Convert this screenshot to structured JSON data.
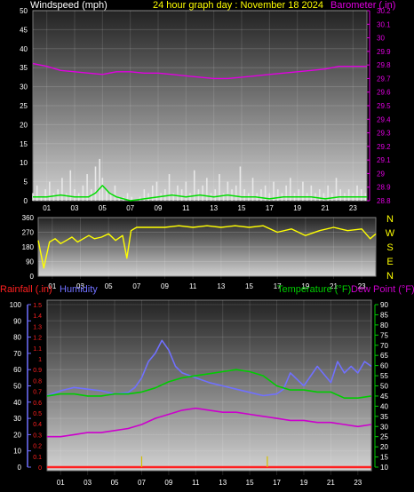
{
  "header": {
    "wind_title": "Windspeed (mph)",
    "center_title": "24 hour graph day : November 18 2024",
    "baro_title": "Barometer (.in)"
  },
  "bottom_titles": {
    "rain": "Rainfall (.in)",
    "humidity": "Humidity",
    "temperature": "Temperature (°F)",
    "dewpoint": "Dew Point (°F)"
  },
  "direction_letters": [
    "N",
    "W",
    "S",
    "E",
    "N"
  ],
  "colors": {
    "wind_gust": "#e8e8e8",
    "wind_avg": "#00dd00",
    "barometer": "#e000e0",
    "direction": "#ffff00",
    "humidity": "#7070ff",
    "temperature": "#00cc00",
    "dewpoint": "#cc00cc",
    "rain": "#ff2020",
    "title_yellow": "#ffff00",
    "title_white": "#ffffff"
  },
  "chart_data": [
    {
      "type": "line",
      "name": "wind-barometer",
      "x_ticks": [
        "01",
        "03",
        "05",
        "07",
        "09",
        "11",
        "13",
        "15",
        "17",
        "19",
        "21",
        "23"
      ],
      "xlim": [
        0,
        24
      ],
      "y_left_ticks": [
        "0",
        "5",
        "10",
        "15",
        "20",
        "25",
        "30",
        "35",
        "40",
        "45",
        "50"
      ],
      "ylim_left": [
        0,
        50
      ],
      "y_right_ticks": [
        "28.8",
        "28.9",
        "29",
        "29.1",
        "29.2",
        "29.3",
        "29.4",
        "29.5",
        "29.6",
        "29.7",
        "29.8",
        "29.9",
        "30",
        "30.1",
        "30.2"
      ],
      "ylim_right": [
        28.8,
        30.2
      ],
      "series": [
        {
          "name": "Windspeed (mph)",
          "axis": "left",
          "style": "gust",
          "x": [
            0,
            0.3,
            0.6,
            0.9,
            1.2,
            1.5,
            1.8,
            2.1,
            2.4,
            2.7,
            3,
            3.3,
            3.6,
            3.9,
            4.2,
            4.5,
            4.8,
            5,
            5.3,
            5.6,
            5.9,
            6.2,
            6.5,
            6.8,
            7.1,
            7.4,
            7.7,
            8,
            8.3,
            8.6,
            8.9,
            9.2,
            9.5,
            9.8,
            10.1,
            10.4,
            10.7,
            11,
            11.3,
            11.6,
            11.9,
            12.2,
            12.5,
            12.8,
            13.1,
            13.4,
            13.7,
            14,
            14.3,
            14.6,
            14.9,
            15.2,
            15.5,
            15.8,
            16.1,
            16.4,
            16.7,
            17,
            17.3,
            17.6,
            17.9,
            18.2,
            18.5,
            18.8,
            19.1,
            19.4,
            19.7,
            20,
            20.3,
            20.6,
            20.9,
            21.2,
            21.5,
            21.8,
            22.1,
            22.4,
            22.7,
            23,
            23.3,
            23.6,
            23.9
          ],
          "y": [
            2,
            4,
            1,
            3,
            5,
            2,
            3,
            6,
            2,
            8,
            3,
            2,
            4,
            7,
            3,
            9,
            11,
            6,
            3,
            2,
            4,
            1,
            1,
            2,
            1,
            0,
            1,
            3,
            2,
            4,
            5,
            2,
            3,
            7,
            2,
            4,
            3,
            5,
            2,
            8,
            3,
            4,
            6,
            2,
            3,
            7,
            2,
            5,
            3,
            4,
            9,
            3,
            2,
            6,
            2,
            3,
            4,
            2,
            5,
            3,
            2,
            4,
            6,
            2,
            3,
            5,
            2,
            4,
            2,
            3,
            2,
            4,
            2,
            6,
            3,
            2,
            3,
            2,
            4,
            3,
            2
          ]
        },
        {
          "name": "Average wind (mph)",
          "axis": "left",
          "style": "avg",
          "x": [
            0,
            1,
            2,
            3,
            4,
            4.5,
            5,
            5.5,
            6,
            7,
            8,
            9,
            10,
            11,
            12,
            13,
            14,
            15,
            16,
            17,
            18,
            19,
            20,
            21,
            22,
            23,
            24
          ],
          "y": [
            1,
            1,
            1.5,
            1,
            1,
            2,
            4,
            2,
            1,
            0,
            0.5,
            1,
            1.5,
            1,
            1.5,
            1,
            1.5,
            1,
            1,
            0.5,
            1,
            1,
            1,
            0.5,
            1,
            1,
            1
          ]
        },
        {
          "name": "Barometer (.in)",
          "axis": "right",
          "style": "baro",
          "x": [
            0,
            1,
            2,
            3,
            4,
            5,
            6,
            7,
            8,
            9,
            10,
            11,
            12,
            13,
            14,
            15,
            16,
            17,
            18,
            19,
            20,
            21,
            22,
            23,
            24
          ],
          "y": [
            29.81,
            29.79,
            29.76,
            29.75,
            29.74,
            29.73,
            29.75,
            29.75,
            29.74,
            29.74,
            29.73,
            29.72,
            29.71,
            29.7,
            29.7,
            29.71,
            29.72,
            29.73,
            29.74,
            29.75,
            29.76,
            29.77,
            29.79,
            29.79,
            29.79
          ]
        }
      ]
    },
    {
      "type": "line",
      "name": "wind-direction",
      "x_ticks": [
        "01",
        "03",
        "05",
        "07",
        "09",
        "11",
        "13",
        "15",
        "17",
        "19",
        "21",
        "23"
      ],
      "xlim": [
        0,
        24
      ],
      "y_ticks": [
        "0",
        "90",
        "180",
        "270",
        "360"
      ],
      "ylim": [
        0,
        360
      ],
      "series": [
        {
          "name": "Wind direction",
          "x": [
            0,
            0.4,
            0.8,
            1.2,
            1.6,
            2,
            2.4,
            2.8,
            3.2,
            3.6,
            4,
            4.5,
            5,
            5.5,
            6,
            6.3,
            6.6,
            7,
            8,
            9,
            10,
            11,
            12,
            13,
            14,
            15,
            16,
            17,
            18,
            19,
            20,
            21,
            22,
            23,
            23.6,
            24
          ],
          "y": [
            220,
            50,
            210,
            230,
            200,
            220,
            240,
            210,
            230,
            250,
            230,
            240,
            260,
            220,
            250,
            110,
            280,
            300,
            300,
            300,
            310,
            300,
            310,
            300,
            310,
            300,
            310,
            270,
            290,
            250,
            280,
            300,
            280,
            290,
            230,
            260
          ]
        }
      ]
    },
    {
      "type": "line",
      "name": "temp-humidity-rain",
      "x_ticks": [
        "01",
        "03",
        "05",
        "07",
        "09",
        "11",
        "13",
        "15",
        "17",
        "19",
        "21",
        "23"
      ],
      "xlim": [
        0,
        24
      ],
      "y_humidity_ticks": [
        "0",
        "10",
        "20",
        "30",
        "40",
        "50",
        "60",
        "70",
        "80",
        "90",
        "100"
      ],
      "ylim_humidity": [
        0,
        100
      ],
      "y_rain_ticks": [
        "0",
        "0.1",
        "0.2",
        "0.3",
        "0.4",
        "0.5",
        "0.6",
        "0.7",
        "0.8",
        "0.9",
        "1",
        "1.1",
        "1.2",
        "1.3",
        "1.4",
        "1.5"
      ],
      "ylim_rain": [
        0,
        1.5
      ],
      "y_temp_ticks": [
        "10",
        "15",
        "20",
        "25",
        "30",
        "35",
        "40",
        "45",
        "50",
        "55",
        "60",
        "65",
        "70",
        "75",
        "80",
        "85",
        "90"
      ],
      "ylim_temp": [
        10,
        90
      ],
      "series": [
        {
          "name": "Humidity",
          "axis": "humidity",
          "x": [
            0,
            1,
            2,
            3,
            4,
            5,
            6,
            6.5,
            7,
            7.5,
            8,
            8.5,
            9,
            9.5,
            10,
            11,
            12,
            13,
            14,
            15,
            16,
            17,
            17.5,
            18,
            19,
            20,
            21,
            21.5,
            22,
            22.5,
            23,
            23.5,
            24
          ],
          "y": [
            44,
            47,
            49,
            48,
            47,
            45,
            46,
            49,
            55,
            65,
            70,
            78,
            72,
            62,
            58,
            55,
            52,
            50,
            48,
            46,
            44,
            45,
            48,
            58,
            50,
            62,
            52,
            65,
            58,
            62,
            58,
            65,
            62
          ]
        },
        {
          "name": "Temperature (°F)",
          "axis": "temp",
          "x": [
            0,
            1,
            2,
            3,
            4,
            5,
            6,
            7,
            8,
            9,
            10,
            11,
            12,
            13,
            14,
            15,
            16,
            17,
            18,
            19,
            20,
            21,
            22,
            23,
            24
          ],
          "y": [
            45,
            46,
            46,
            45,
            45,
            46,
            46,
            47,
            49,
            52,
            54,
            55,
            56,
            57,
            58,
            57,
            55,
            50,
            48,
            48,
            47,
            47,
            44,
            44,
            45
          ]
        },
        {
          "name": "Dew Point (°F)",
          "axis": "temp",
          "x": [
            0,
            1,
            2,
            3,
            4,
            5,
            6,
            7,
            8,
            9,
            10,
            11,
            12,
            13,
            14,
            15,
            16,
            17,
            18,
            19,
            20,
            21,
            22,
            23,
            24
          ],
          "y": [
            25,
            25,
            26,
            27,
            27,
            28,
            29,
            31,
            34,
            36,
            38,
            39,
            38,
            37,
            37,
            36,
            35,
            34,
            33,
            33,
            32,
            32,
            31,
            30,
            31
          ]
        },
        {
          "name": "Rainfall (.in)",
          "axis": "rain",
          "x": [
            0,
            6.9,
            7,
            7.1,
            16.2,
            16.3,
            16.4,
            24
          ],
          "y": [
            0,
            0,
            0.1,
            0,
            0,
            0.1,
            0,
            0
          ]
        }
      ]
    }
  ]
}
